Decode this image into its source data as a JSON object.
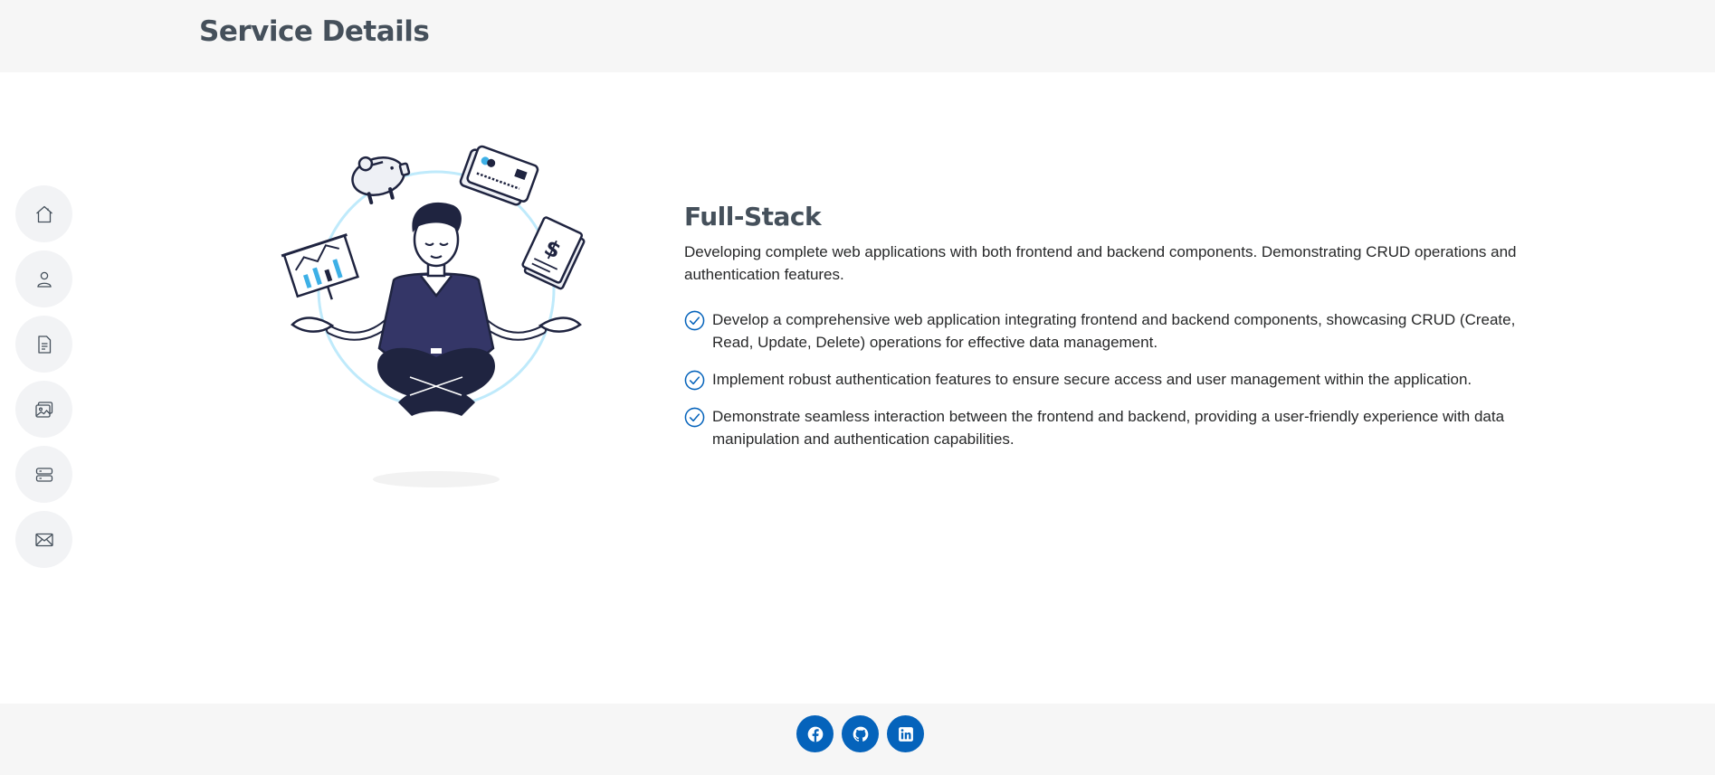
{
  "header": {
    "title": "Service Details"
  },
  "nav": {
    "items": [
      {
        "icon": "home-icon"
      },
      {
        "icon": "person-icon"
      },
      {
        "icon": "file-text-icon"
      },
      {
        "icon": "images-icon"
      },
      {
        "icon": "server-icon"
      },
      {
        "icon": "envelope-icon"
      }
    ]
  },
  "service": {
    "title": "Full-Stack",
    "description": "Developing complete web applications with both frontend and backend components. Demonstrating CRUD operations and authentication features.",
    "features": [
      "Develop a comprehensive web application integrating frontend and backend components, showcasing CRUD (Create, Read, Update, Delete) operations for effective data management.",
      "Implement robust authentication features to ensure secure access and user management within the application.",
      "Demonstrate seamless interaction between the frontend and backend, providing a user-friendly experience with data manipulation and authentication capabilities."
    ]
  },
  "footer": {
    "socials": [
      {
        "icon": "facebook-icon"
      },
      {
        "icon": "github-icon"
      },
      {
        "icon": "linkedin-icon"
      }
    ]
  },
  "colors": {
    "accent": "#0563bb",
    "heading": "#45505b",
    "band": "#f6f6f6",
    "figure_shirt": "#343667",
    "figure_dark": "#1f2440"
  }
}
